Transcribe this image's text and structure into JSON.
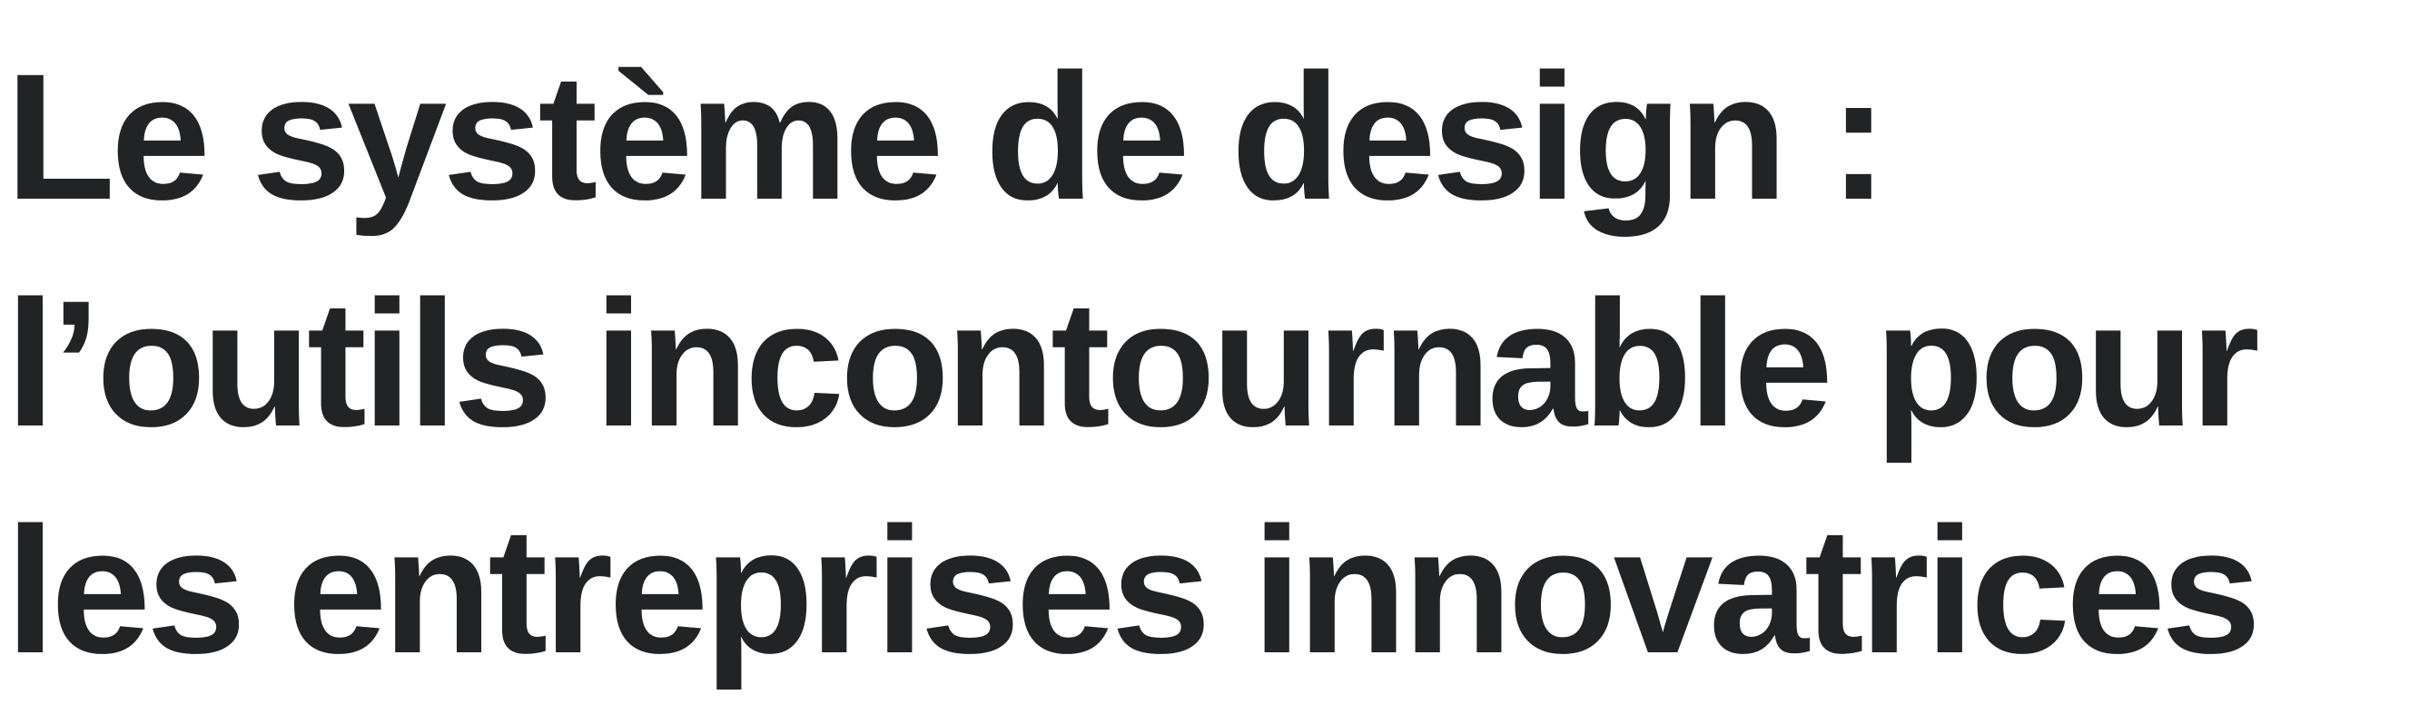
{
  "headline": {
    "lines": [
      "Le système de design :",
      "l’outils incontournable pour",
      "les entreprises innovatrices"
    ]
  },
  "colors": {
    "text": "#222325",
    "background": "#ffffff"
  }
}
